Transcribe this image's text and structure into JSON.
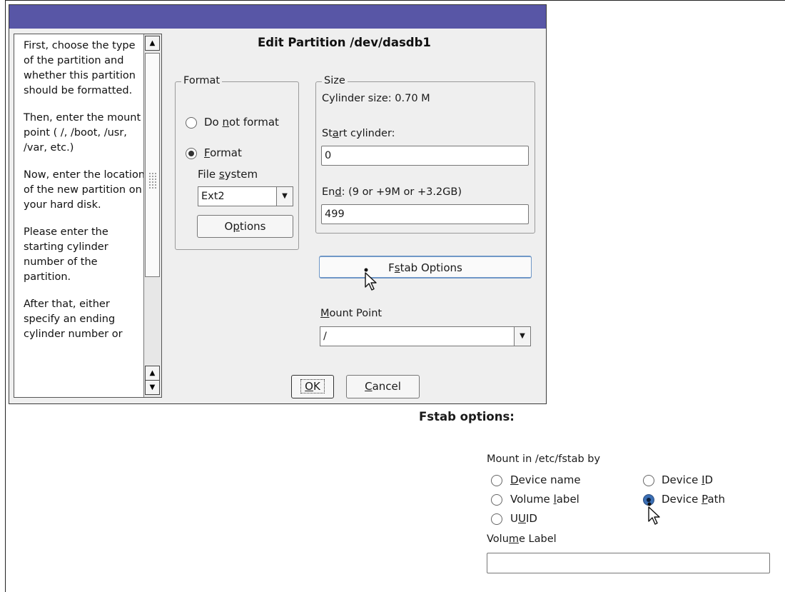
{
  "dialog": {
    "heading": "Edit Partition /dev/dasdb1",
    "help": {
      "paragraphs": [
        "First, choose the type of the partition and whether this partition should be formatted.",
        "Then, enter the mount point ( /, /boot, /usr, /var, etc.)",
        "Now, enter the location of the new partition on your hard disk.",
        "Please enter the starting cylinder number of the partition.",
        "After that, either specify an ending cylinder number or"
      ]
    },
    "format": {
      "legend": "Format",
      "do_not_format": {
        "pre": "Do ",
        "u": "n",
        "post": "ot format"
      },
      "format_option": {
        "pre": "",
        "u": "F",
        "post": "ormat"
      },
      "file_system_label": {
        "pre": "File ",
        "u": "s",
        "post": "ystem"
      },
      "file_system_value": "Ext2",
      "options_button": {
        "pre": "O",
        "u": "p",
        "post": "tions"
      }
    },
    "size": {
      "legend": "Size",
      "cylinder_size": "Cylinder size: 0.70 M",
      "start_label": {
        "pre": "St",
        "u": "a",
        "post": "rt cylinder:"
      },
      "start_value": "0",
      "end_label": {
        "pre": "En",
        "u": "d",
        "post": ":  (9 or +9M or +3.2GB)"
      },
      "end_value": "499"
    },
    "fstab_button": {
      "pre": "F",
      "u": "s",
      "post": "tab Options"
    },
    "mount_point": {
      "label": {
        "pre": "",
        "u": "M",
        "post": "ount Point"
      },
      "value": "/"
    },
    "ok_button": {
      "pre": "",
      "u": "O",
      "post": "K"
    },
    "cancel_button": {
      "pre": "",
      "u": "C",
      "post": "ancel"
    }
  },
  "fstab": {
    "title": "Fstab options:",
    "mount_by_label": "Mount in /etc/fstab by",
    "device_name": {
      "pre": "",
      "u": "D",
      "post": "evice name"
    },
    "device_id": {
      "pre": "Device ",
      "u": "I",
      "post": "D"
    },
    "volume_label": {
      "pre": "Volume ",
      "u": "l",
      "post": "abel"
    },
    "device_path": {
      "pre": "Device ",
      "u": "P",
      "post": "ath"
    },
    "uuid": {
      "pre": "U",
      "u": "U",
      "post": "ID"
    },
    "volume_label_field": {
      "pre": "Volu",
      "u": "m",
      "post": "e Label"
    },
    "selected": "Device Path"
  },
  "colors": {
    "titlebar": "#5856a6",
    "dialog_bg": "#efefef",
    "selected_radio": "#3b6fb5"
  }
}
